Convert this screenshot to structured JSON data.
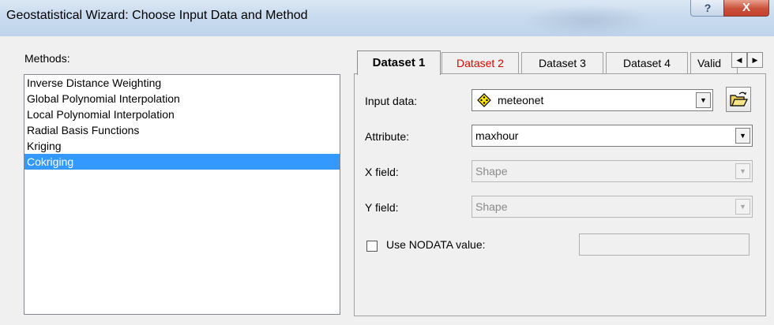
{
  "window": {
    "title": "Geostatistical Wizard: Choose Input Data and Method",
    "help_label": "?",
    "close_label": "X"
  },
  "methods": {
    "label": "Methods:",
    "items": [
      {
        "label": "Inverse Distance Weighting",
        "selected": false
      },
      {
        "label": "Global Polynomial Interpolation",
        "selected": false
      },
      {
        "label": "Local Polynomial Interpolation",
        "selected": false
      },
      {
        "label": "Radial Basis Functions",
        "selected": false
      },
      {
        "label": "Kriging",
        "selected": false
      },
      {
        "label": "Cokriging",
        "selected": true
      }
    ]
  },
  "tabs": [
    {
      "label": "Dataset 1",
      "active": true,
      "error": false
    },
    {
      "label": "Dataset 2",
      "active": false,
      "error": true
    },
    {
      "label": "Dataset 3",
      "active": false,
      "error": false
    },
    {
      "label": "Dataset 4",
      "active": false,
      "error": false
    },
    {
      "label": "Valid",
      "active": false,
      "error": false
    }
  ],
  "form": {
    "input_data_label": "Input data:",
    "input_data_value": "meteonet",
    "attribute_label": "Attribute:",
    "attribute_value": "maxhour",
    "x_field_label": "X field:",
    "x_field_value": "Shape",
    "y_field_label": "Y field:",
    "y_field_value": "Shape",
    "nodata_label": "Use NODATA value:",
    "nodata_checked": false,
    "nodata_value": ""
  },
  "icons": {
    "scroll_left": "triangle-left-icon",
    "scroll_right": "triangle-right-icon",
    "dropdown": "chevron-down-icon",
    "layer": "point-layer-diamond-icon",
    "browse": "open-folder-icon"
  },
  "colors": {
    "selection": "#3399ff",
    "error_tab": "#e00000",
    "close_button": "#c9503b"
  }
}
